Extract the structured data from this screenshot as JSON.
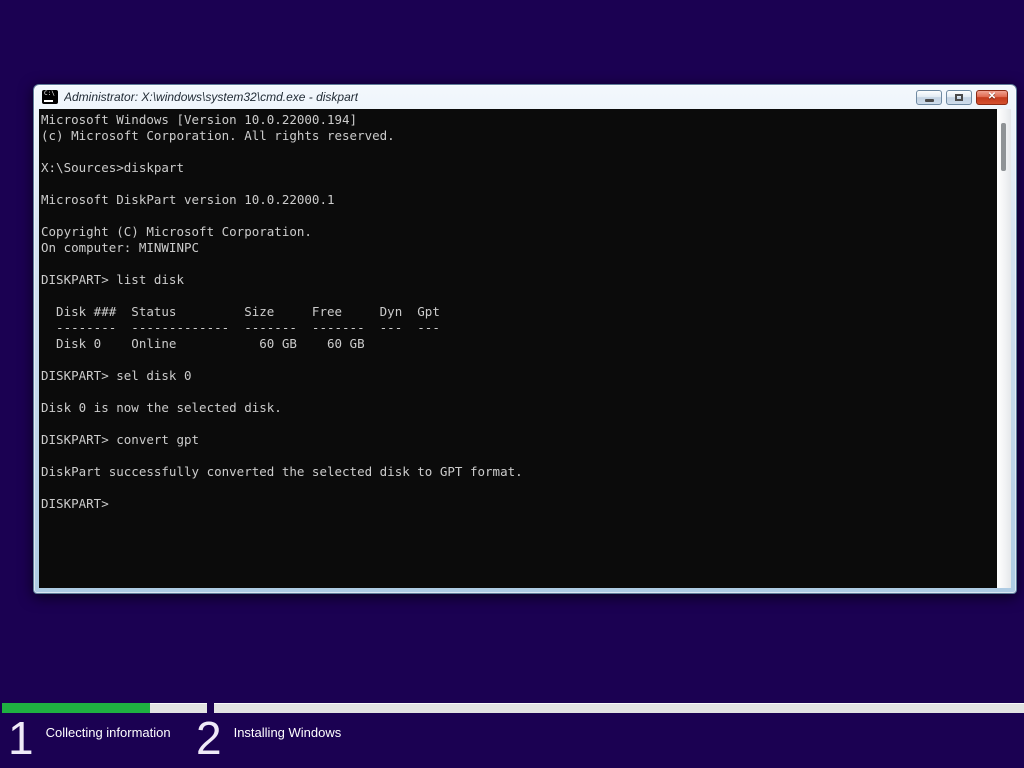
{
  "window": {
    "title": "Administrator: X:\\windows\\system32\\cmd.exe - diskpart",
    "icon": "cmd-prompt-icon",
    "icon_prompt": "C:\\",
    "controls": {
      "minimize": "minimize",
      "maximize": "maximize",
      "close": "close",
      "close_glyph": "✕"
    }
  },
  "terminal": {
    "lines": [
      "Microsoft Windows [Version 10.0.22000.194]",
      "(c) Microsoft Corporation. All rights reserved.",
      "",
      "X:\\Sources>diskpart",
      "",
      "Microsoft DiskPart version 10.0.22000.1",
      "",
      "Copyright (C) Microsoft Corporation.",
      "On computer: MINWINPC",
      "",
      "DISKPART> list disk",
      "",
      "  Disk ###  Status         Size     Free     Dyn  Gpt",
      "  --------  -------------  -------  -------  ---  ---",
      "  Disk 0    Online           60 GB    60 GB",
      "",
      "DISKPART> sel disk 0",
      "",
      "Disk 0 is now the selected disk.",
      "",
      "DISKPART> convert gpt",
      "",
      "DiskPart successfully converted the selected disk to GPT format.",
      "",
      "DISKPART>"
    ],
    "disk_table": {
      "headers": [
        "Disk ###",
        "Status",
        "Size",
        "Free",
        "Dyn",
        "Gpt"
      ],
      "rows": [
        [
          "Disk 0",
          "Online",
          "60 GB",
          "60 GB",
          "",
          ""
        ]
      ]
    }
  },
  "setup": {
    "steps": [
      {
        "number": "1",
        "label": "Collecting information",
        "progress_percent": 72,
        "state": "in-progress"
      },
      {
        "number": "2",
        "label": "Installing Windows",
        "progress_percent": 0,
        "state": "pending"
      }
    ]
  },
  "colors": {
    "background": "#1b0152",
    "console_bg": "#0b0b0b",
    "console_text": "#cccccc",
    "progress_green": "#1fb141",
    "progress_track": "#e2e2e2",
    "titlebar_text": "#1f2933"
  }
}
